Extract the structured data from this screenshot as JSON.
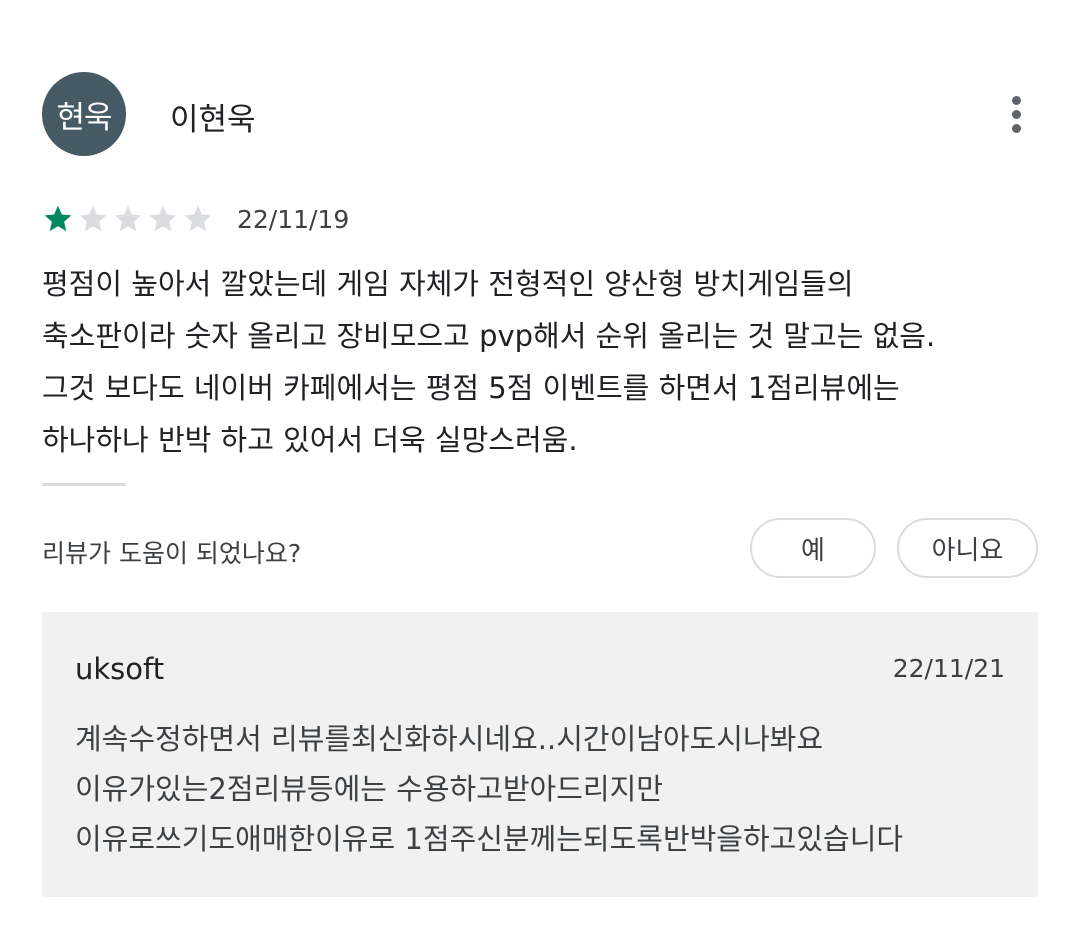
{
  "review": {
    "avatar_text": "현욱",
    "author": "이현욱",
    "rating": 1,
    "max_rating": 5,
    "date": "22/11/19",
    "text_lines": [
      "평점이 높아서 깔았는데 게임 자체가 전형적인 양산형 방치게임들의",
      "축소판이라 숫자 올리고 장비모으고 pvp해서 순위 올리는 것 말고는 없음.",
      "그것 보다도 네이버 카페에서는 평점 5점 이벤트를 하면서 1점리뷰에는",
      "하나하나 반박 하고 있어서 더욱 실망스러움."
    ]
  },
  "helpful": {
    "question": "리뷰가 도움이 되었나요?",
    "yes_label": "예",
    "no_label": "아니요"
  },
  "developer_reply": {
    "name": "uksoft",
    "date": "22/11/21",
    "text_lines": [
      "계속수정하면서 리뷰를최신화하시네요..시간이남아도시나봐요",
      "이유가있는2점리뷰등에는 수용하고받아드리지만",
      "이유로쓰기도애매한이유로 1점주신분께는되도록반박을하고있습니다"
    ]
  },
  "colors": {
    "avatar_bg": "#455a64",
    "star_filled": "#01875f",
    "star_empty": "#dadce0",
    "reply_bg": "#f1f1f1"
  },
  "icons": {
    "more": "more-vert-icon",
    "star": "star-icon"
  }
}
